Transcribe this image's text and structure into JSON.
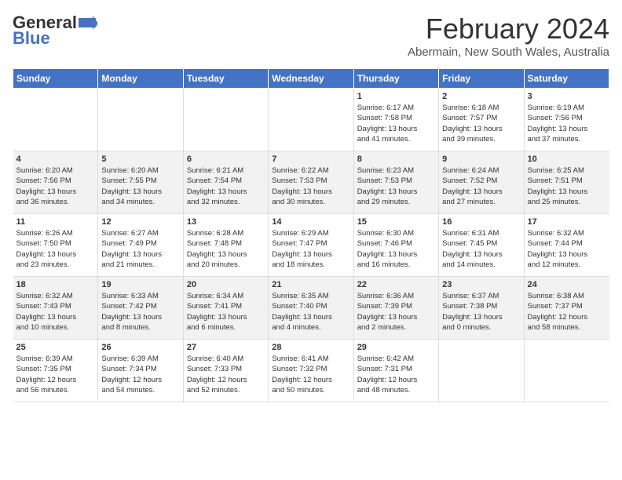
{
  "header": {
    "logo_general": "General",
    "logo_blue": "Blue",
    "main_title": "February 2024",
    "subtitle": "Abermain, New South Wales, Australia"
  },
  "calendar": {
    "days_of_week": [
      "Sunday",
      "Monday",
      "Tuesday",
      "Wednesday",
      "Thursday",
      "Friday",
      "Saturday"
    ],
    "weeks": [
      {
        "cells": [
          {
            "day": "",
            "content": ""
          },
          {
            "day": "",
            "content": ""
          },
          {
            "day": "",
            "content": ""
          },
          {
            "day": "",
            "content": ""
          },
          {
            "day": "1",
            "content": "Sunrise: 6:17 AM\nSunset: 7:58 PM\nDaylight: 13 hours\nand 41 minutes."
          },
          {
            "day": "2",
            "content": "Sunrise: 6:18 AM\nSunset: 7:57 PM\nDaylight: 13 hours\nand 39 minutes."
          },
          {
            "day": "3",
            "content": "Sunrise: 6:19 AM\nSunset: 7:56 PM\nDaylight: 13 hours\nand 37 minutes."
          }
        ]
      },
      {
        "cells": [
          {
            "day": "4",
            "content": "Sunrise: 6:20 AM\nSunset: 7:56 PM\nDaylight: 13 hours\nand 36 minutes."
          },
          {
            "day": "5",
            "content": "Sunrise: 6:20 AM\nSunset: 7:55 PM\nDaylight: 13 hours\nand 34 minutes."
          },
          {
            "day": "6",
            "content": "Sunrise: 6:21 AM\nSunset: 7:54 PM\nDaylight: 13 hours\nand 32 minutes."
          },
          {
            "day": "7",
            "content": "Sunrise: 6:22 AM\nSunset: 7:53 PM\nDaylight: 13 hours\nand 30 minutes."
          },
          {
            "day": "8",
            "content": "Sunrise: 6:23 AM\nSunset: 7:53 PM\nDaylight: 13 hours\nand 29 minutes."
          },
          {
            "day": "9",
            "content": "Sunrise: 6:24 AM\nSunset: 7:52 PM\nDaylight: 13 hours\nand 27 minutes."
          },
          {
            "day": "10",
            "content": "Sunrise: 6:25 AM\nSunset: 7:51 PM\nDaylight: 13 hours\nand 25 minutes."
          }
        ]
      },
      {
        "cells": [
          {
            "day": "11",
            "content": "Sunrise: 6:26 AM\nSunset: 7:50 PM\nDaylight: 13 hours\nand 23 minutes."
          },
          {
            "day": "12",
            "content": "Sunrise: 6:27 AM\nSunset: 7:49 PM\nDaylight: 13 hours\nand 21 minutes."
          },
          {
            "day": "13",
            "content": "Sunrise: 6:28 AM\nSunset: 7:48 PM\nDaylight: 13 hours\nand 20 minutes."
          },
          {
            "day": "14",
            "content": "Sunrise: 6:29 AM\nSunset: 7:47 PM\nDaylight: 13 hours\nand 18 minutes."
          },
          {
            "day": "15",
            "content": "Sunrise: 6:30 AM\nSunset: 7:46 PM\nDaylight: 13 hours\nand 16 minutes."
          },
          {
            "day": "16",
            "content": "Sunrise: 6:31 AM\nSunset: 7:45 PM\nDaylight: 13 hours\nand 14 minutes."
          },
          {
            "day": "17",
            "content": "Sunrise: 6:32 AM\nSunset: 7:44 PM\nDaylight: 13 hours\nand 12 minutes."
          }
        ]
      },
      {
        "cells": [
          {
            "day": "18",
            "content": "Sunrise: 6:32 AM\nSunset: 7:43 PM\nDaylight: 13 hours\nand 10 minutes."
          },
          {
            "day": "19",
            "content": "Sunrise: 6:33 AM\nSunset: 7:42 PM\nDaylight: 13 hours\nand 8 minutes."
          },
          {
            "day": "20",
            "content": "Sunrise: 6:34 AM\nSunset: 7:41 PM\nDaylight: 13 hours\nand 6 minutes."
          },
          {
            "day": "21",
            "content": "Sunrise: 6:35 AM\nSunset: 7:40 PM\nDaylight: 13 hours\nand 4 minutes."
          },
          {
            "day": "22",
            "content": "Sunrise: 6:36 AM\nSunset: 7:39 PM\nDaylight: 13 hours\nand 2 minutes."
          },
          {
            "day": "23",
            "content": "Sunrise: 6:37 AM\nSunset: 7:38 PM\nDaylight: 13 hours\nand 0 minutes."
          },
          {
            "day": "24",
            "content": "Sunrise: 6:38 AM\nSunset: 7:37 PM\nDaylight: 12 hours\nand 58 minutes."
          }
        ]
      },
      {
        "cells": [
          {
            "day": "25",
            "content": "Sunrise: 6:39 AM\nSunset: 7:35 PM\nDaylight: 12 hours\nand 56 minutes."
          },
          {
            "day": "26",
            "content": "Sunrise: 6:39 AM\nSunset: 7:34 PM\nDaylight: 12 hours\nand 54 minutes."
          },
          {
            "day": "27",
            "content": "Sunrise: 6:40 AM\nSunset: 7:33 PM\nDaylight: 12 hours\nand 52 minutes."
          },
          {
            "day": "28",
            "content": "Sunrise: 6:41 AM\nSunset: 7:32 PM\nDaylight: 12 hours\nand 50 minutes."
          },
          {
            "day": "29",
            "content": "Sunrise: 6:42 AM\nSunset: 7:31 PM\nDaylight: 12 hours\nand 48 minutes."
          },
          {
            "day": "",
            "content": ""
          },
          {
            "day": "",
            "content": ""
          }
        ]
      }
    ]
  }
}
